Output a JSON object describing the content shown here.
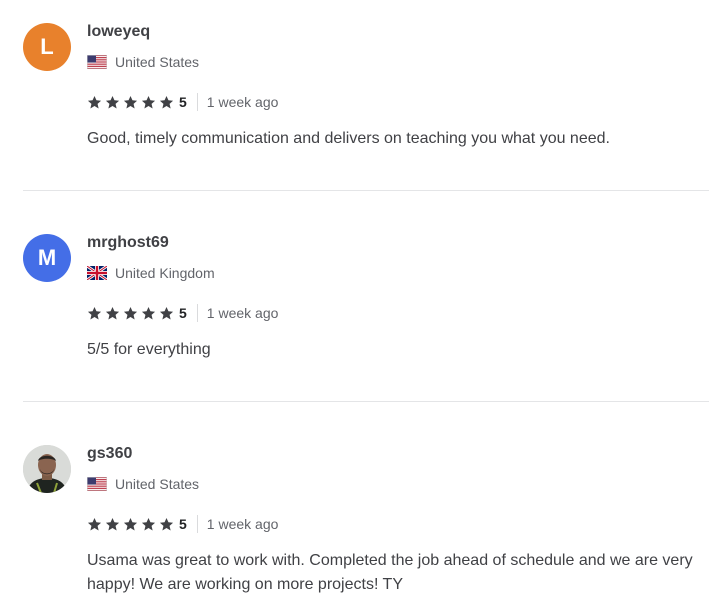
{
  "reviews": [
    {
      "avatar_letter": "L",
      "avatar_color": "#e8812c",
      "username": "loweyeq",
      "country": "United States",
      "flag": "us-flag-icon",
      "rating": "5",
      "time": "1 week ago",
      "text": "Good, timely communication and delivers on teaching you what you need."
    },
    {
      "avatar_letter": "M",
      "avatar_color": "#446ee7",
      "username": "mrghost69",
      "country": "United Kingdom",
      "flag": "uk-flag-icon",
      "rating": "5",
      "time": "1 week ago",
      "text": "5/5 for everything"
    },
    {
      "avatar_letter": "",
      "avatar_color": "#cfd2cf",
      "username": "gs360",
      "country": "United States",
      "flag": "us-flag-icon",
      "rating": "5",
      "time": "1 week ago",
      "text": "Usama was great to work with. Completed the job ahead of schedule and we are very happy! We are working on more projects! TY"
    }
  ],
  "colors": {
    "star": "#404145",
    "divider": "#e4e5e7"
  }
}
